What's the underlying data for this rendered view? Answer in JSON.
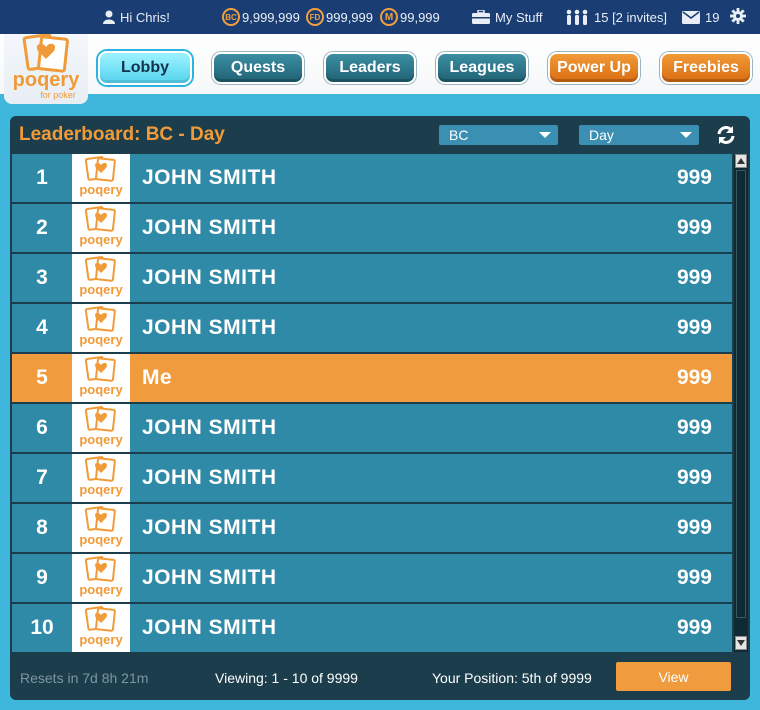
{
  "topbar": {
    "greeting": "Hi Chris!",
    "bc_coin": "BC",
    "bc_amount": "9,999,999",
    "fd_coin": "FD",
    "fd_amount": "999,999",
    "m_coin": "M",
    "m_amount": "99,999",
    "my_stuff": "My Stuff",
    "friends": "15 [2 invites]",
    "messages": "19"
  },
  "logo": {
    "text": "poqery",
    "subtext": "for poker"
  },
  "nav": {
    "lobby": "Lobby",
    "quests": "Quests",
    "leaders": "Leaders",
    "leagues": "Leagues",
    "power_up": "Power Up",
    "freebies": "Freebies"
  },
  "leaderboard": {
    "title": "Leaderboard: BC - Day",
    "currency_select": "BC",
    "period_select": "Day",
    "rows": [
      {
        "rank": "1",
        "name": "JOHN SMITH",
        "score": "999",
        "me": false
      },
      {
        "rank": "2",
        "name": "JOHN SMITH",
        "score": "999",
        "me": false
      },
      {
        "rank": "3",
        "name": "JOHN SMITH",
        "score": "999",
        "me": false
      },
      {
        "rank": "4",
        "name": "JOHN SMITH",
        "score": "999",
        "me": false
      },
      {
        "rank": "5",
        "name": "Me",
        "score": "999",
        "me": true
      },
      {
        "rank": "6",
        "name": "JOHN SMITH",
        "score": "999",
        "me": false
      },
      {
        "rank": "7",
        "name": "JOHN SMITH",
        "score": "999",
        "me": false
      },
      {
        "rank": "8",
        "name": "JOHN SMITH",
        "score": "999",
        "me": false
      },
      {
        "rank": "9",
        "name": "JOHN SMITH",
        "score": "999",
        "me": false
      },
      {
        "rank": "10",
        "name": "JOHN SMITH",
        "score": "999",
        "me": false
      }
    ]
  },
  "footer": {
    "resets": "Resets in 7d 8h 21m",
    "viewing": "Viewing: 1 - 10 of 9999",
    "position": "Your Position: 5th of 9999",
    "view_button": "View"
  },
  "colors": {
    "accent_orange": "#f19a38",
    "row_teal": "#2f8aa7",
    "panel_dark": "#1c3e4c",
    "topbar_navy": "#1a3e73"
  }
}
